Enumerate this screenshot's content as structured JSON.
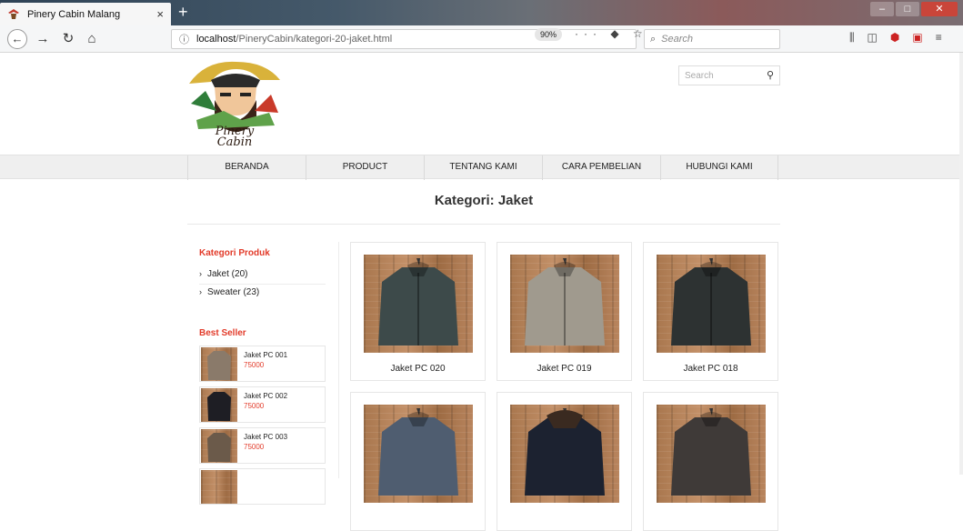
{
  "browser": {
    "tab_title": "Pinery Cabin Malang",
    "tab_close": "×",
    "new_tab": "+",
    "url_host": "localhost",
    "url_path": "/PineryCabin/kategori-20-jaket.html",
    "zoom": "90%",
    "search_placeholder": "Search",
    "url_actions": "··· ◆ ☆",
    "tool_icons": [
      "library-icon",
      "sidebar-icon",
      "ublock-icon",
      "screenshot-icon",
      "menu-icon"
    ]
  },
  "site": {
    "logo_text": "Pinery Cabin",
    "search_placeholder": "Search",
    "menu": [
      "BERANDA",
      "PRODUCT",
      "TENTANG KAMI",
      "CARA PEMBELIAN",
      "HUBUNGI KAMI"
    ],
    "page_title": "Kategori: Jaket"
  },
  "sidebar": {
    "categories_heading": "Kategori Produk",
    "categories": [
      {
        "label": "Jaket (20)"
      },
      {
        "label": "Sweater (23)"
      }
    ],
    "bestseller_heading": "Best Seller",
    "bestsellers": [
      {
        "name": "Jaket PC 001",
        "price": "75000",
        "color": "#8a7a6a"
      },
      {
        "name": "Jaket PC 002",
        "price": "75000",
        "color": "#1e1e24"
      },
      {
        "name": "Jaket PC 003",
        "price": "75000",
        "color": "#6b5a4a"
      }
    ]
  },
  "products": [
    {
      "name": "Jaket PC 020",
      "jacket_color": "#3d4a4a"
    },
    {
      "name": "Jaket PC 019",
      "jacket_color": "#a09a8e"
    },
    {
      "name": "Jaket PC 018",
      "jacket_color": "#2d3232"
    },
    {
      "name": "",
      "jacket_color": "#4f5d70"
    },
    {
      "name": "",
      "jacket_color": "#1c2230"
    },
    {
      "name": "",
      "jacket_color": "#3f3a38"
    }
  ]
}
